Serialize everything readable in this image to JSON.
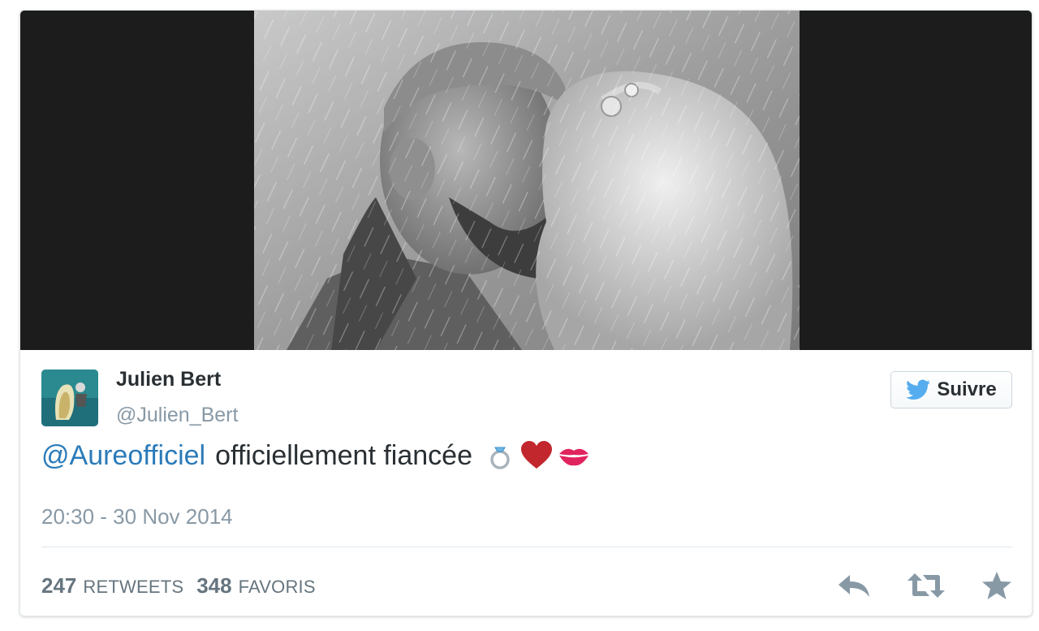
{
  "tweet": {
    "display_name": "Julien Bert",
    "handle": "@Julien_Bert",
    "follow_label": "Suivre",
    "text": {
      "mention": "@Aureofficiel",
      "body": "officiellement fiancée"
    },
    "emoji_icons": [
      "ring-icon",
      "red-heart-icon",
      "kiss-mark-icon"
    ],
    "timestamp": "20:30 - 30 Nov 2014",
    "stats": {
      "retweets_count": "247",
      "retweets_label": "RETWEETS",
      "favorites_count": "348",
      "favorites_label": "FAVORIS"
    },
    "actions": [
      "reply-icon",
      "retweet-icon",
      "favorite-star-icon"
    ]
  },
  "colors": {
    "link": "#2b7bb9",
    "twitter_blue": "#55acee",
    "text": "#292f33",
    "muted": "#8899a6",
    "heart": "#c1272d"
  }
}
